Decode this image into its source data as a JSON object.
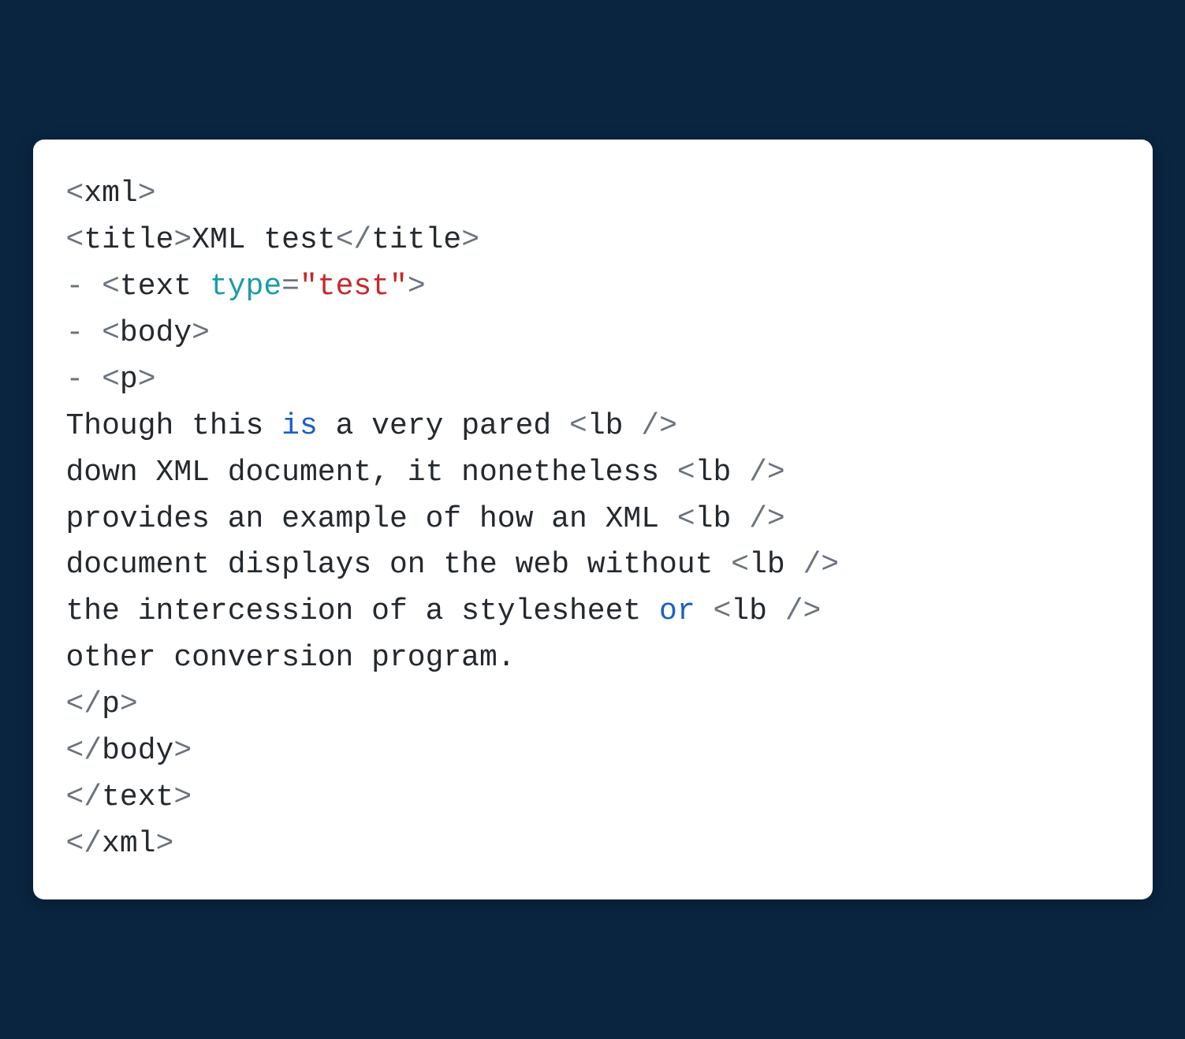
{
  "code": {
    "lines": [
      {
        "segments": [
          {
            "text": "<",
            "cls": "punct"
          },
          {
            "text": "xml",
            "cls": ""
          },
          {
            "text": ">",
            "cls": "punct"
          }
        ]
      },
      {
        "segments": [
          {
            "text": "<",
            "cls": "punct"
          },
          {
            "text": "title",
            "cls": ""
          },
          {
            "text": ">",
            "cls": "punct"
          },
          {
            "text": "XML test",
            "cls": ""
          },
          {
            "text": "</",
            "cls": "punct"
          },
          {
            "text": "title",
            "cls": ""
          },
          {
            "text": ">",
            "cls": "punct"
          }
        ]
      },
      {
        "segments": [
          {
            "text": "- ",
            "cls": "punct"
          },
          {
            "text": "<",
            "cls": "punct"
          },
          {
            "text": "text ",
            "cls": ""
          },
          {
            "text": "type",
            "cls": "attr-name"
          },
          {
            "text": "=",
            "cls": "punct"
          },
          {
            "text": "\"test\"",
            "cls": "attr-value"
          },
          {
            "text": ">",
            "cls": "punct"
          }
        ]
      },
      {
        "segments": [
          {
            "text": "- ",
            "cls": "punct"
          },
          {
            "text": "<",
            "cls": "punct"
          },
          {
            "text": "body",
            "cls": ""
          },
          {
            "text": ">",
            "cls": "punct"
          }
        ]
      },
      {
        "segments": [
          {
            "text": "- ",
            "cls": "punct"
          },
          {
            "text": "<",
            "cls": "punct"
          },
          {
            "text": "p",
            "cls": ""
          },
          {
            "text": ">",
            "cls": "punct"
          }
        ]
      },
      {
        "segments": [
          {
            "text": "Though this ",
            "cls": ""
          },
          {
            "text": "is",
            "cls": "keyword"
          },
          {
            "text": " a very pared ",
            "cls": ""
          },
          {
            "text": "<",
            "cls": "punct"
          },
          {
            "text": "lb ",
            "cls": ""
          },
          {
            "text": "/>",
            "cls": "punct"
          }
        ]
      },
      {
        "segments": [
          {
            "text": "down XML document, it nonetheless ",
            "cls": ""
          },
          {
            "text": "<",
            "cls": "punct"
          },
          {
            "text": "lb ",
            "cls": ""
          },
          {
            "text": "/>",
            "cls": "punct"
          }
        ]
      },
      {
        "segments": [
          {
            "text": "provides an example of how an XML ",
            "cls": ""
          },
          {
            "text": "<",
            "cls": "punct"
          },
          {
            "text": "lb ",
            "cls": ""
          },
          {
            "text": "/>",
            "cls": "punct"
          }
        ]
      },
      {
        "segments": [
          {
            "text": "document displays on the web without ",
            "cls": ""
          },
          {
            "text": "<",
            "cls": "punct"
          },
          {
            "text": "lb ",
            "cls": ""
          },
          {
            "text": "/>",
            "cls": "punct"
          }
        ]
      },
      {
        "segments": [
          {
            "text": "the intercession of a stylesheet ",
            "cls": ""
          },
          {
            "text": "or",
            "cls": "keyword"
          },
          {
            "text": " ",
            "cls": ""
          },
          {
            "text": "<",
            "cls": "punct"
          },
          {
            "text": "lb ",
            "cls": ""
          },
          {
            "text": "/>",
            "cls": "punct"
          }
        ]
      },
      {
        "segments": [
          {
            "text": "other conversion program.",
            "cls": ""
          }
        ]
      },
      {
        "segments": [
          {
            "text": "</",
            "cls": "punct"
          },
          {
            "text": "p",
            "cls": ""
          },
          {
            "text": ">",
            "cls": "punct"
          }
        ]
      },
      {
        "segments": [
          {
            "text": "</",
            "cls": "punct"
          },
          {
            "text": "body",
            "cls": ""
          },
          {
            "text": ">",
            "cls": "punct"
          }
        ]
      },
      {
        "segments": [
          {
            "text": "</",
            "cls": "punct"
          },
          {
            "text": "text",
            "cls": ""
          },
          {
            "text": ">",
            "cls": "punct"
          }
        ]
      },
      {
        "segments": [
          {
            "text": "</",
            "cls": "punct"
          },
          {
            "text": "xml",
            "cls": ""
          },
          {
            "text": ">",
            "cls": "punct"
          }
        ]
      }
    ]
  }
}
